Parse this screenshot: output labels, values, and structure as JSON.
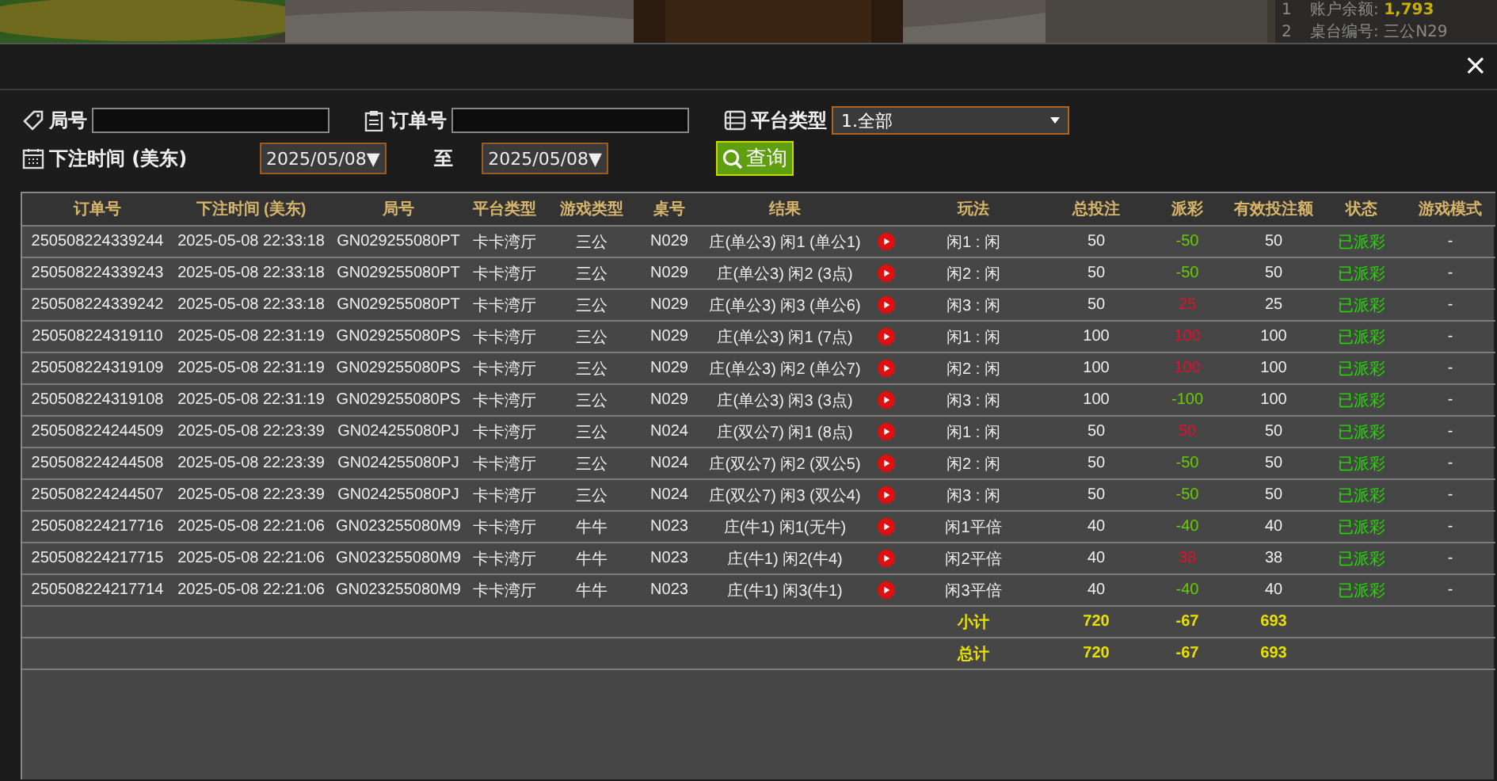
{
  "background": {
    "account_label": "账户余额:",
    "balance": "1,793",
    "table_label": "桌台编号:",
    "table_value": "三公N29",
    "markers": [
      "1",
      "2"
    ]
  },
  "dialog": {
    "close": "×"
  },
  "filters": {
    "round_label": "局号",
    "order_label": "订单号",
    "platform_label": "平台类型",
    "platform_value": "1.全部",
    "time_label": "下注时间 (美东)",
    "date_from": "2025/05/08▼",
    "to_label": "至",
    "date_to": "2025/05/08▼",
    "query": "查询"
  },
  "table": {
    "columns": [
      {
        "label": "订单号"
      },
      {
        "label": "下注时间 (美东)"
      },
      {
        "label": "局号"
      },
      {
        "label": "平台类型"
      },
      {
        "label": "游戏类型"
      },
      {
        "label": "桌号"
      },
      {
        "label": "结果"
      },
      {
        "label": "玩法"
      },
      {
        "label": "总投注"
      },
      {
        "label": "派彩"
      },
      {
        "label": "有效投注额"
      },
      {
        "label": "状态"
      },
      {
        "label": "游戏模式"
      }
    ],
    "rows": [
      {
        "order": "250508224339244",
        "time": "2025-05-08 22:33:18",
        "round": "GN029255080PT",
        "platform": "卡卡湾厅",
        "game": "三公",
        "table": "N029",
        "result": "庄(单公3) 闲1 (单公1)",
        "play": "闲1 : 闲",
        "bet": "50",
        "payout": "-50",
        "color": "#66cc00",
        "valid": "50",
        "status": "已派彩",
        "mode": "-"
      },
      {
        "order": "250508224339243",
        "time": "2025-05-08 22:33:18",
        "round": "GN029255080PT",
        "platform": "卡卡湾厅",
        "game": "三公",
        "table": "N029",
        "result": "庄(单公3) 闲2 (3点)",
        "play": "闲2 : 闲",
        "bet": "50",
        "payout": "-50",
        "color": "#66cc00",
        "valid": "50",
        "status": "已派彩",
        "mode": "-"
      },
      {
        "order": "250508224339242",
        "time": "2025-05-08 22:33:18",
        "round": "GN029255080PT",
        "platform": "卡卡湾厅",
        "game": "三公",
        "table": "N029",
        "result": "庄(单公3) 闲3 (单公6)",
        "play": "闲3 : 闲",
        "bet": "50",
        "payout": "25",
        "color": "#e0102e",
        "valid": "25",
        "status": "已派彩",
        "mode": "-"
      },
      {
        "order": "250508224319110",
        "time": "2025-05-08 22:31:19",
        "round": "GN029255080PS",
        "platform": "卡卡湾厅",
        "game": "三公",
        "table": "N029",
        "result": "庄(单公3) 闲1 (7点)",
        "play": "闲1 : 闲",
        "bet": "100",
        "payout": "100",
        "color": "#e0102e",
        "valid": "100",
        "status": "已派彩",
        "mode": "-"
      },
      {
        "order": "250508224319109",
        "time": "2025-05-08 22:31:19",
        "round": "GN029255080PS",
        "platform": "卡卡湾厅",
        "game": "三公",
        "table": "N029",
        "result": "庄(单公3) 闲2 (单公7)",
        "play": "闲2 : 闲",
        "bet": "100",
        "payout": "100",
        "color": "#e0102e",
        "valid": "100",
        "status": "已派彩",
        "mode": "-"
      },
      {
        "order": "250508224319108",
        "time": "2025-05-08 22:31:19",
        "round": "GN029255080PS",
        "platform": "卡卡湾厅",
        "game": "三公",
        "table": "N029",
        "result": "庄(单公3) 闲3 (3点)",
        "play": "闲3 : 闲",
        "bet": "100",
        "payout": "-100",
        "color": "#66cc00",
        "valid": "100",
        "status": "已派彩",
        "mode": "-"
      },
      {
        "order": "250508224244509",
        "time": "2025-05-08 22:23:39",
        "round": "GN024255080PJ",
        "platform": "卡卡湾厅",
        "game": "三公",
        "table": "N024",
        "result": "庄(双公7) 闲1 (8点)",
        "play": "闲1 : 闲",
        "bet": "50",
        "payout": "50",
        "color": "#e0102e",
        "valid": "50",
        "status": "已派彩",
        "mode": "-"
      },
      {
        "order": "250508224244508",
        "time": "2025-05-08 22:23:39",
        "round": "GN024255080PJ",
        "platform": "卡卡湾厅",
        "game": "三公",
        "table": "N024",
        "result": "庄(双公7) 闲2 (双公5)",
        "play": "闲2 : 闲",
        "bet": "50",
        "payout": "-50",
        "color": "#66cc00",
        "valid": "50",
        "status": "已派彩",
        "mode": "-"
      },
      {
        "order": "250508224244507",
        "time": "2025-05-08 22:23:39",
        "round": "GN024255080PJ",
        "platform": "卡卡湾厅",
        "game": "三公",
        "table": "N024",
        "result": "庄(双公7) 闲3 (双公4)",
        "play": "闲3 : 闲",
        "bet": "50",
        "payout": "-50",
        "color": "#66cc00",
        "valid": "50",
        "status": "已派彩",
        "mode": "-"
      },
      {
        "order": "250508224217716",
        "time": "2025-05-08 22:21:06",
        "round": "GN023255080M9",
        "platform": "卡卡湾厅",
        "game": "牛牛",
        "table": "N023",
        "result": "庄(牛1) 闲1(无牛)",
        "play": "闲1平倍",
        "bet": "40",
        "payout": "-40",
        "color": "#66cc00",
        "valid": "40",
        "status": "已派彩",
        "mode": "-"
      },
      {
        "order": "250508224217715",
        "time": "2025-05-08 22:21:06",
        "round": "GN023255080M9",
        "platform": "卡卡湾厅",
        "game": "牛牛",
        "table": "N023",
        "result": "庄(牛1) 闲2(牛4)",
        "play": "闲2平倍",
        "bet": "40",
        "payout": "38",
        "color": "#e0102e",
        "valid": "38",
        "status": "已派彩",
        "mode": "-"
      },
      {
        "order": "250508224217714",
        "time": "2025-05-08 22:21:06",
        "round": "GN023255080M9",
        "platform": "卡卡湾厅",
        "game": "牛牛",
        "table": "N023",
        "result": "庄(牛1) 闲3(牛1)",
        "play": "闲3平倍",
        "bet": "40",
        "payout": "-40",
        "color": "#66cc00",
        "valid": "40",
        "status": "已派彩",
        "mode": "-"
      }
    ],
    "totals": [
      {
        "label": "小计",
        "bet": "720",
        "payout": "-67",
        "valid": "693"
      },
      {
        "label": "总计",
        "bet": "720",
        "payout": "-67",
        "valid": "693"
      }
    ]
  }
}
